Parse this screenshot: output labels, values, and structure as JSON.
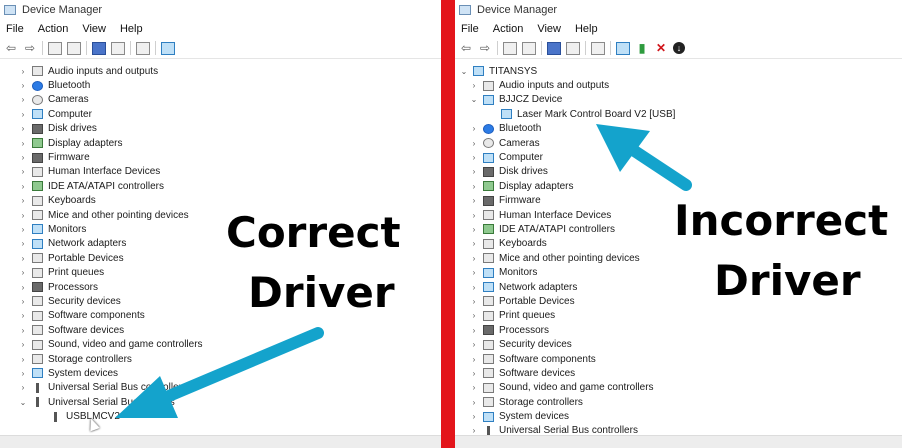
{
  "left": {
    "title": "Device Manager",
    "menu": [
      "File",
      "Action",
      "View",
      "Help"
    ],
    "tree": [
      {
        "label": "Audio inputs and outputs",
        "chev": "›",
        "icon": "speaker-icon"
      },
      {
        "label": "Bluetooth",
        "chev": "›",
        "icon": "bluetooth-icon"
      },
      {
        "label": "Cameras",
        "chev": "›",
        "icon": "camera-icon"
      },
      {
        "label": "Computer",
        "chev": "›",
        "icon": "computer-icon"
      },
      {
        "label": "Disk drives",
        "chev": "›",
        "icon": "disk-icon"
      },
      {
        "label": "Display adapters",
        "chev": "›",
        "icon": "display-adapter-icon"
      },
      {
        "label": "Firmware",
        "chev": "›",
        "icon": "firmware-icon"
      },
      {
        "label": "Human Interface Devices",
        "chev": "›",
        "icon": "hid-icon"
      },
      {
        "label": "IDE ATA/ATAPI controllers",
        "chev": "›",
        "icon": "ide-icon"
      },
      {
        "label": "Keyboards",
        "chev": "›",
        "icon": "keyboard-icon"
      },
      {
        "label": "Mice and other pointing devices",
        "chev": "›",
        "icon": "mouse-icon"
      },
      {
        "label": "Monitors",
        "chev": "›",
        "icon": "monitor-icon"
      },
      {
        "label": "Network adapters",
        "chev": "›",
        "icon": "network-icon"
      },
      {
        "label": "Portable Devices",
        "chev": "›",
        "icon": "portable-device-icon"
      },
      {
        "label": "Print queues",
        "chev": "›",
        "icon": "printer-icon"
      },
      {
        "label": "Processors",
        "chev": "›",
        "icon": "processor-icon"
      },
      {
        "label": "Security devices",
        "chev": "›",
        "icon": "security-icon"
      },
      {
        "label": "Software components",
        "chev": "›",
        "icon": "software-component-icon"
      },
      {
        "label": "Software devices",
        "chev": "›",
        "icon": "software-device-icon"
      },
      {
        "label": "Sound, video and game controllers",
        "chev": "›",
        "icon": "sound-icon"
      },
      {
        "label": "Storage controllers",
        "chev": "›",
        "icon": "storage-icon"
      },
      {
        "label": "System devices",
        "chev": "›",
        "icon": "system-icon"
      },
      {
        "label": "Universal Serial Bus controllers",
        "chev": "›",
        "icon": "usb-icon"
      },
      {
        "label": "Universal Serial Bus devices",
        "chev": "⌄",
        "icon": "usb-icon"
      },
      {
        "label": "USBLMCV2",
        "chev": "",
        "icon": "usb-device-icon",
        "child": true
      }
    ],
    "overlay_line1": "Correct",
    "overlay_line2": "Driver"
  },
  "right": {
    "title": "Device Manager",
    "menu": [
      "File",
      "Action",
      "View",
      "Help"
    ],
    "tree": [
      {
        "label": "TITANSYS",
        "chev": "⌄",
        "icon": "computer-icon",
        "root": true
      },
      {
        "label": "Audio inputs and outputs",
        "chev": "›",
        "icon": "speaker-icon"
      },
      {
        "label": "BJJCZ Device",
        "chev": "⌄",
        "icon": "device-icon"
      },
      {
        "label": "Laser Mark Control Board V2 [USB]",
        "chev": "",
        "icon": "device-icon",
        "child": true
      },
      {
        "label": "Bluetooth",
        "chev": "›",
        "icon": "bluetooth-icon"
      },
      {
        "label": "Cameras",
        "chev": "›",
        "icon": "camera-icon"
      },
      {
        "label": "Computer",
        "chev": "›",
        "icon": "computer-icon"
      },
      {
        "label": "Disk drives",
        "chev": "›",
        "icon": "disk-icon"
      },
      {
        "label": "Display adapters",
        "chev": "›",
        "icon": "display-adapter-icon"
      },
      {
        "label": "Firmware",
        "chev": "›",
        "icon": "firmware-icon"
      },
      {
        "label": "Human Interface Devices",
        "chev": "›",
        "icon": "hid-icon"
      },
      {
        "label": "IDE ATA/ATAPI controllers",
        "chev": "›",
        "icon": "ide-icon"
      },
      {
        "label": "Keyboards",
        "chev": "›",
        "icon": "keyboard-icon"
      },
      {
        "label": "Mice and other pointing devices",
        "chev": "›",
        "icon": "mouse-icon"
      },
      {
        "label": "Monitors",
        "chev": "›",
        "icon": "monitor-icon"
      },
      {
        "label": "Network adapters",
        "chev": "›",
        "icon": "network-icon"
      },
      {
        "label": "Portable Devices",
        "chev": "›",
        "icon": "portable-device-icon"
      },
      {
        "label": "Print queues",
        "chev": "›",
        "icon": "printer-icon"
      },
      {
        "label": "Processors",
        "chev": "›",
        "icon": "processor-icon"
      },
      {
        "label": "Security devices",
        "chev": "›",
        "icon": "security-icon"
      },
      {
        "label": "Software components",
        "chev": "›",
        "icon": "software-component-icon"
      },
      {
        "label": "Software devices",
        "chev": "›",
        "icon": "software-device-icon"
      },
      {
        "label": "Sound, video and game controllers",
        "chev": "›",
        "icon": "sound-icon"
      },
      {
        "label": "Storage controllers",
        "chev": "›",
        "icon": "storage-icon"
      },
      {
        "label": "System devices",
        "chev": "›",
        "icon": "system-icon"
      },
      {
        "label": "Universal Serial Bus controllers",
        "chev": "›",
        "icon": "usb-icon"
      }
    ],
    "overlay_line1": "Incorrect",
    "overlay_line2": "Driver"
  },
  "colors": {
    "divider": "#e3151b",
    "arrow": "#14a3cc"
  }
}
